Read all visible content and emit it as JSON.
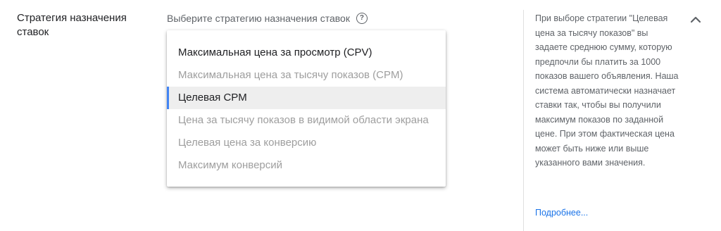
{
  "section": {
    "title": "Стратегия назначения ставок"
  },
  "field": {
    "label": "Выберите стратегию назначения ставок",
    "help_icon": "help-circle-icon"
  },
  "dropdown": {
    "options": [
      {
        "label": "Максимальная цена за просмотр (CPV)",
        "state": "enabled"
      },
      {
        "label": "Максимальная цена за тысячу показов (CPM)",
        "state": "disabled"
      },
      {
        "label": "Целевая CPM",
        "state": "selected"
      },
      {
        "label": "Цена за тысячу показов в видимой области экрана",
        "state": "disabled"
      },
      {
        "label": "Целевая цена за конверсию",
        "state": "disabled"
      },
      {
        "label": "Максимум конверсий",
        "state": "disabled"
      }
    ]
  },
  "help_panel": {
    "text": "При выборе стратегии \"Целевая цена за тысячу показов\" вы задаете среднюю сумму, которую предпочли бы платить за 1000 показов вашего объявления. Наша система автоматически назначает ставки так, чтобы вы получили максимум показов по заданной цене. При этом фактическая цена может быть ниже или выше указанного вами значения.",
    "link": "Подробнее...",
    "collapse_icon": "chevron-up-icon"
  },
  "colors": {
    "accent": "#4285f4",
    "link": "#1a73e8",
    "disabled_text": "#9e9e9e",
    "selected_bg": "#eeeeee"
  }
}
